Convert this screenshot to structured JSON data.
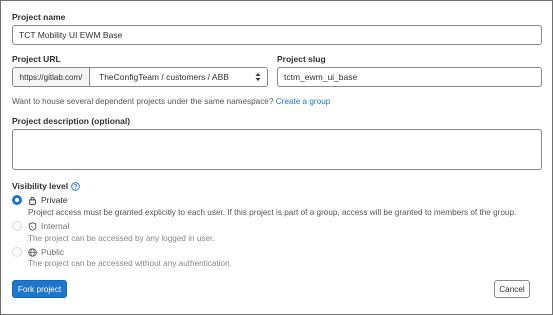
{
  "project_name": {
    "label": "Project name",
    "value": "TCT Mobility UI EWM Base"
  },
  "project_url": {
    "label": "Project URL",
    "prefix": "https://gitlab.com/",
    "namespace": "TheConfigTeam / customers / ABB"
  },
  "project_slug": {
    "label": "Project slug",
    "value": "tctm_ewm_ui_base"
  },
  "group_hint": {
    "text": "Want to house several dependent projects under the same namespace?",
    "link": "Create a group"
  },
  "project_description": {
    "label": "Project description (optional)",
    "value": ""
  },
  "visibility": {
    "label": "Visibility level",
    "selected": "Private",
    "options": [
      {
        "label": "Private",
        "icon": "lock-icon",
        "description": "Project access must be granted explicitly to each user. If this project is part of a group, access will be granted to members of the group."
      },
      {
        "label": "Internal",
        "icon": "shield-icon",
        "description": "The project can be accessed by any logged in user."
      },
      {
        "label": "Public",
        "icon": "globe-icon",
        "description": "The project can be accessed without any authentication."
      }
    ]
  },
  "actions": {
    "fork_label": "Fork project",
    "cancel_label": "Cancel"
  },
  "colors": {
    "primary": "#1f75cb",
    "text": "#303030",
    "border": "#89888d"
  }
}
